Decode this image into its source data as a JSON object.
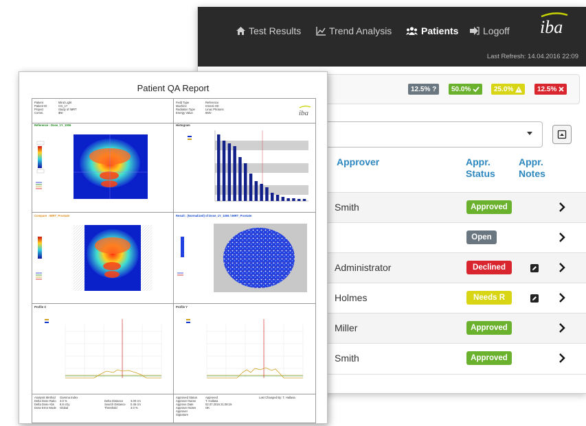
{
  "nav": {
    "items": [
      {
        "label": "Test Results",
        "icon": "home-icon"
      },
      {
        "label": "Trend Analysis",
        "icon": "line-chart-icon"
      },
      {
        "label": "Patients",
        "icon": "users-icon"
      },
      {
        "label": "Logoff",
        "icon": "logout-icon"
      }
    ],
    "last_refresh": "Last Refresh: 14.04.2016 22:09",
    "logo_text": "iba"
  },
  "filters": {
    "badges": [
      {
        "label": "12.5% ?",
        "color": "#6b7780"
      },
      {
        "label": "50.0%",
        "color": "#6ab12d"
      },
      {
        "label": "25.0%",
        "color": "#d8d515"
      },
      {
        "label": "12.5%",
        "color": "#d9262e"
      }
    ]
  },
  "table": {
    "headers": {
      "approver": "Approver",
      "status_line1": "Appr.",
      "status_line2": "Status",
      "notes_line1": "Appr.",
      "notes_line2": "Notes"
    },
    "rows": [
      {
        "approver": "Smith",
        "status": "Approved",
        "status_color": "#6ab12d",
        "note": false
      },
      {
        "approver": "",
        "status": "Open",
        "status_color": "#6b7780",
        "note": false
      },
      {
        "approver": "Administrator",
        "status": "Declined",
        "status_color": "#d9262e",
        "note": true
      },
      {
        "approver": "Holmes",
        "status": "Needs R",
        "status_color": "#d8d515",
        "note": true
      },
      {
        "approver": "Miller",
        "status": "Approved",
        "status_color": "#6ab12d",
        "note": false
      },
      {
        "approver": "Smith",
        "status": "Approved",
        "status_color": "#6ab12d",
        "note": false
      }
    ]
  },
  "report": {
    "title": "Patient QA Report",
    "logo_text": "iba",
    "header_left": [
      "Patient",
      "Patient ID",
      "Project",
      "Comm."
    ],
    "header_left_values": [
      "Mind Light",
      "CG_17",
      "Study of IMRT",
      "$NI"
    ],
    "header_right": [
      "Field Type",
      "Machine",
      "Radiation Type",
      "Energy Value"
    ],
    "header_right_values": [
      "Reference",
      "Intensi HD",
      "Linac Photons",
      "6MV"
    ],
    "panels": {
      "reference": "Reference : Dose_1Y_1006",
      "histogram": "Histogram",
      "compare": "Compare : IMRT_Prostate",
      "result": "Result : (Normalized) of Dose_1Y_1006 / IMRT_Prostate",
      "profile_x": "Profile X",
      "profile_y": "Profile Y"
    },
    "histogram_values": [
      0.97,
      0.88,
      0.84,
      0.8,
      0.64,
      0.55,
      0.4,
      0.29,
      0.25,
      0.2,
      0.12,
      0.09,
      0.06,
      0.04,
      0.04,
      0.03,
      0.03
    ],
    "footer_left": [
      "Analysis Method",
      "Delta Dose Ratio",
      "Delta Dose Abs",
      "Dose Error Mode"
    ],
    "footer_left_values": [
      "Gamma Index",
      "3.0 %",
      "6.8 cGy",
      "Global"
    ],
    "footer_mid": [
      "Delta Distance",
      "Search Distance",
      "Threshold"
    ],
    "footer_mid_values": [
      "3.00 cm",
      "0.45 cm",
      "3.0 %"
    ],
    "footer_right": [
      "Approved Status",
      "Approver Name",
      "Approve Date",
      "Approver Notes",
      "Approver",
      "Signature"
    ],
    "footer_right_values": [
      "Approved",
      "T. Hallasa",
      "02.07.2016 21:08:15",
      "OK",
      "",
      ""
    ],
    "last_changed": "Last Changed By: T. Hallasa"
  }
}
